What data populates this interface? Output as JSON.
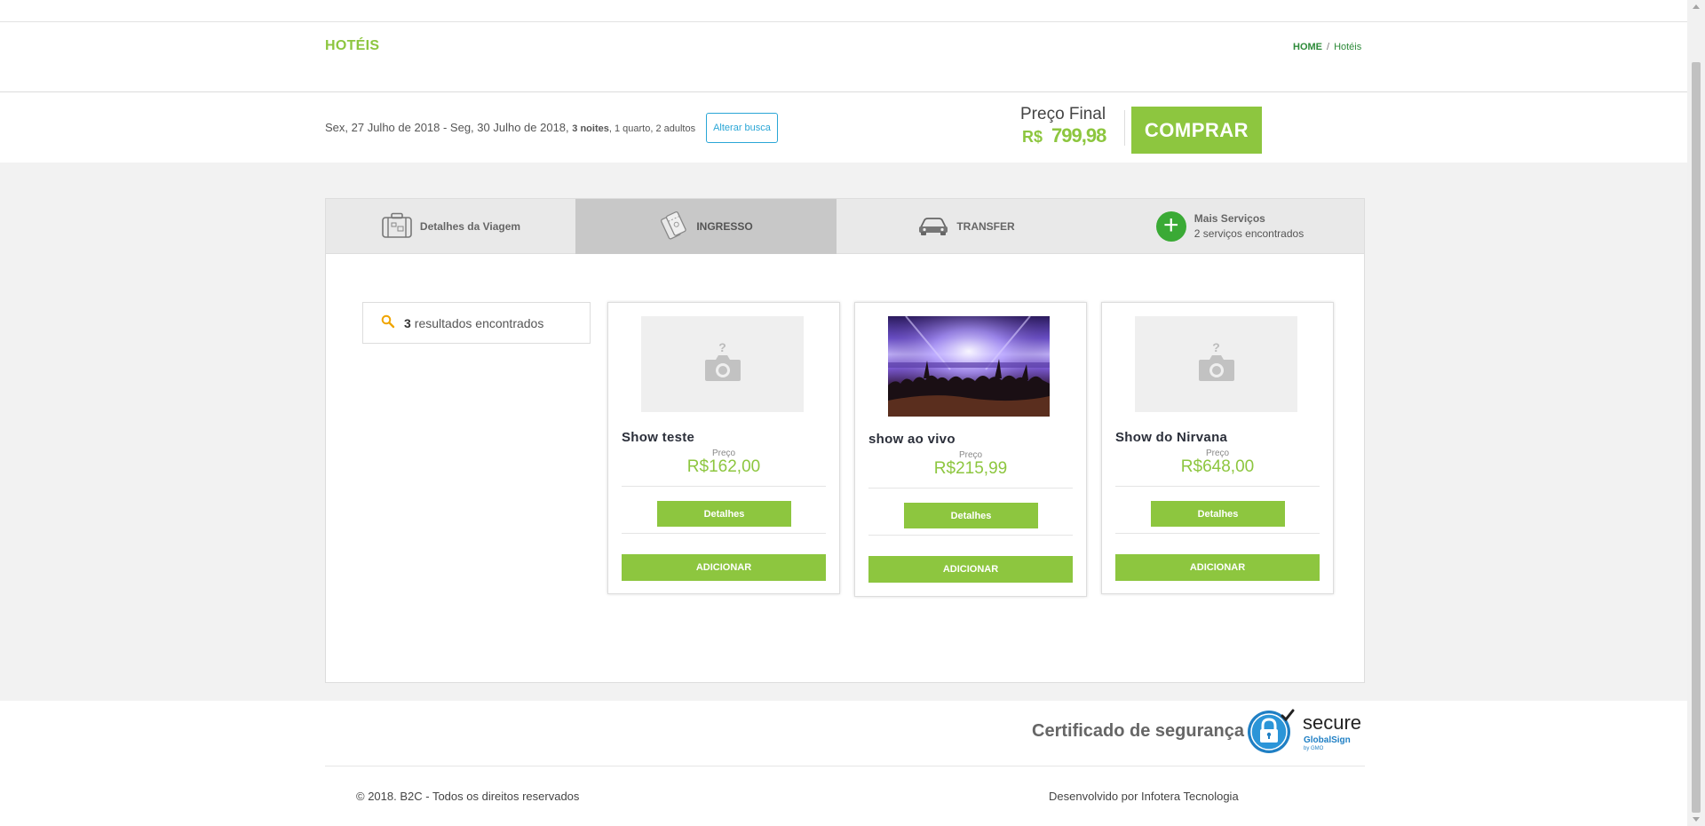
{
  "header": {
    "title": "HOTÉIS",
    "breadcrumb_home": "HOME",
    "breadcrumb_sep": "/",
    "breadcrumb_current": "Hotéis"
  },
  "summary": {
    "dates": "Sex, 27 Julho de 2018 - Seg, 30 Julho de 2018,",
    "nights": "3 noites",
    "rooms_guests": ", 1 quarto, 2 adultos",
    "alter_label": "Alterar busca",
    "price_label": "Preço Final",
    "currency": "R$",
    "price_value": "799,98",
    "buy_label": "COMPRAR"
  },
  "tabs": [
    {
      "label": "Detalhes da Viagem",
      "icon": "suitcase-icon",
      "active": false
    },
    {
      "label": "INGRESSO",
      "icon": "ticket-icon",
      "active": true
    },
    {
      "label": "TRANSFER",
      "icon": "car-icon",
      "active": false
    },
    {
      "label": "Mais Serviços",
      "sub": "2 serviços encontrados",
      "icon": "plus-icon",
      "active": false
    }
  ],
  "results": {
    "count": "3",
    "text": "resultados encontrados"
  },
  "cards": [
    {
      "title": "Show teste",
      "price_label": "Preço",
      "price": "R$162,00",
      "details_label": "Detalhes",
      "add_label": "ADICIONAR",
      "image": "placeholder"
    },
    {
      "title": "show ao vivo",
      "price_label": "Preço",
      "price": "R$215,99",
      "details_label": "Detalhes",
      "add_label": "ADICIONAR",
      "image": "concert-photo"
    },
    {
      "title": "Show do Nirvana",
      "price_label": "Preço",
      "price": "R$648,00",
      "details_label": "Detalhes",
      "add_label": "ADICIONAR",
      "image": "placeholder"
    }
  ],
  "footer": {
    "cert_label": "Certificado de segurança",
    "seal_text": "secure",
    "seal_brand": "GlobalSign",
    "seal_sub": "by GMO",
    "copyright": "© 2018. B2C - Todos os direitos reservados",
    "developer": "Desenvolvido por Infotera Tecnologia"
  },
  "colors": {
    "accent": "#8dc63f",
    "link": "#2aa6d6",
    "breadcrumb": "#2e8b3a",
    "plus": "#3aaa35"
  }
}
